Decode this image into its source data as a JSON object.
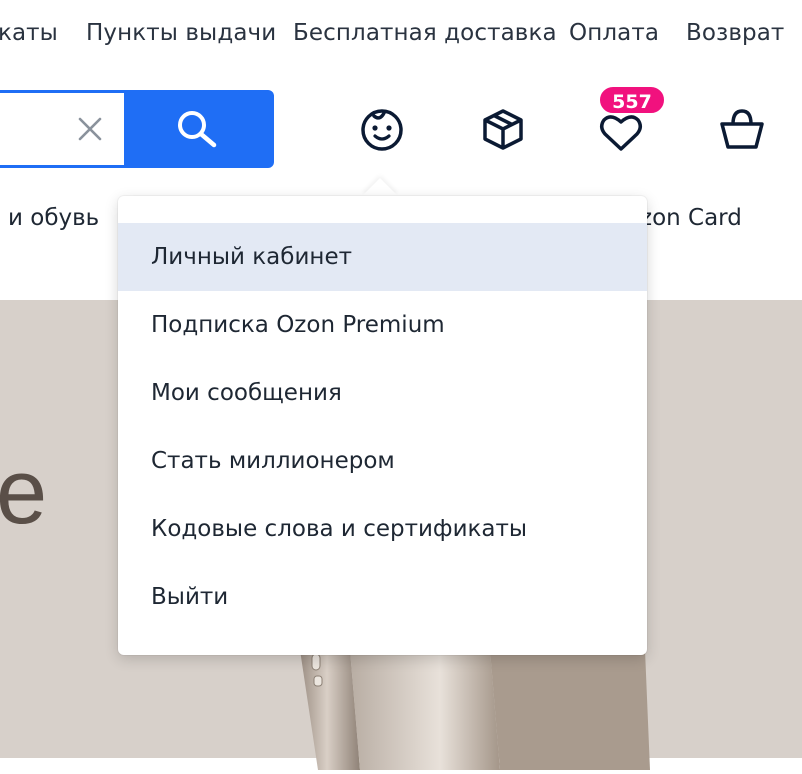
{
  "top_links": [
    "каты",
    "Пункты выдачи",
    "Бесплатная доставка",
    "Оплата",
    "Возврат"
  ],
  "search": {
    "clear_icon": "close-icon",
    "button_icon": "search-icon"
  },
  "header_icons": {
    "profile": "baby-face-icon",
    "orders": "box-icon",
    "favorites": "heart-icon",
    "favorites_count": "557",
    "cart": "basket-icon"
  },
  "nav": {
    "left_item": "и обувь",
    "right_item": "zon Card"
  },
  "banner": {
    "letter": "e"
  },
  "user_menu": {
    "items": [
      "Личный кабинет",
      "Подписка Ozon Premium",
      "Мои сообщения",
      "Стать миллионером",
      "Кодовые слова и сертификаты",
      "Выйти"
    ],
    "active_index": 0
  },
  "colors": {
    "accent": "#1f6ef5",
    "badge": "#f1117e",
    "menu_active": "#e3e9f4",
    "banner_bg": "#d7d0ca"
  }
}
